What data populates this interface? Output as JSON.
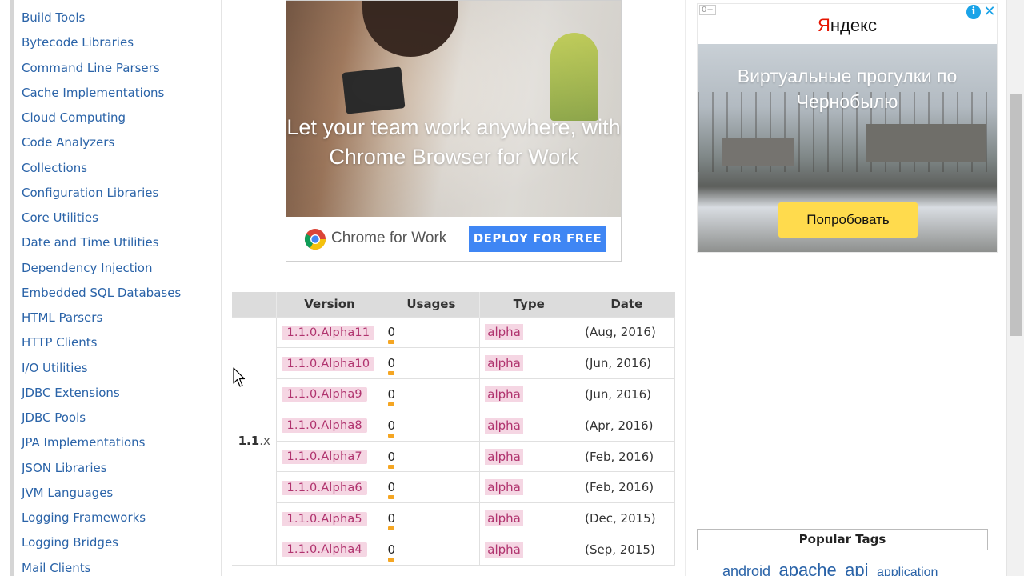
{
  "sidebar": {
    "items": [
      {
        "label": "Build Tools"
      },
      {
        "label": "Bytecode Libraries"
      },
      {
        "label": "Command Line Parsers"
      },
      {
        "label": "Cache Implementations"
      },
      {
        "label": "Cloud Computing"
      },
      {
        "label": "Code Analyzers"
      },
      {
        "label": "Collections"
      },
      {
        "label": "Configuration Libraries"
      },
      {
        "label": "Core Utilities"
      },
      {
        "label": "Date and Time Utilities"
      },
      {
        "label": "Dependency Injection"
      },
      {
        "label": "Embedded SQL Databases"
      },
      {
        "label": "HTML Parsers"
      },
      {
        "label": "HTTP Clients"
      },
      {
        "label": "I/O Utilities"
      },
      {
        "label": "JDBC Extensions"
      },
      {
        "label": "JDBC Pools"
      },
      {
        "label": "JPA Implementations"
      },
      {
        "label": "JSON Libraries"
      },
      {
        "label": "JVM Languages"
      },
      {
        "label": "Logging Frameworks"
      },
      {
        "label": "Logging Bridges"
      },
      {
        "label": "Mail Clients"
      }
    ]
  },
  "ad_center": {
    "headline": "Let your team work anywhere, with Chrome Browser for Work",
    "product": "Chrome for Work",
    "cta": "DEPLOY FOR FREE"
  },
  "ad_right": {
    "age_badge": "0+",
    "info_icon": "i",
    "close_icon": "✕",
    "brand_first": "Я",
    "brand_rest": "ндекс",
    "title": "Виртуальные прогулки по Чернобылю",
    "cta": "Попробовать"
  },
  "versions": {
    "headers": {
      "version": "Version",
      "usages": "Usages",
      "type": "Type",
      "date": "Date"
    },
    "group_label": "1.1",
    "group_suffix": ".x",
    "rows": [
      {
        "version": "1.1.0.Alpha11",
        "usages": "0",
        "type": "alpha",
        "date": "(Aug, 2016)"
      },
      {
        "version": "1.1.0.Alpha10",
        "usages": "0",
        "type": "alpha",
        "date": "(Jun, 2016)"
      },
      {
        "version": "1.1.0.Alpha9",
        "usages": "0",
        "type": "alpha",
        "date": "(Jun, 2016)"
      },
      {
        "version": "1.1.0.Alpha8",
        "usages": "0",
        "type": "alpha",
        "date": "(Apr, 2016)"
      },
      {
        "version": "1.1.0.Alpha7",
        "usages": "0",
        "type": "alpha",
        "date": "(Feb, 2016)"
      },
      {
        "version": "1.1.0.Alpha6",
        "usages": "0",
        "type": "alpha",
        "date": "(Feb, 2016)"
      },
      {
        "version": "1.1.0.Alpha5",
        "usages": "0",
        "type": "alpha",
        "date": "(Dec, 2015)"
      },
      {
        "version": "1.1.0.Alpha4",
        "usages": "0",
        "type": "alpha",
        "date": "(Sep, 2015)"
      }
    ]
  },
  "popular_tags": {
    "title": "Popular Tags",
    "tags": [
      "android",
      "apache",
      "api",
      "application"
    ]
  },
  "colors": {
    "link": "#2a63a8",
    "pill_bg": "#f5d6e3",
    "pill_text": "#b0336e",
    "usage_bar": "#f5a623",
    "header_bg": "#dcdcdc",
    "deploy_button": "#3f86f4",
    "yandex_button": "#ffdb4d"
  }
}
